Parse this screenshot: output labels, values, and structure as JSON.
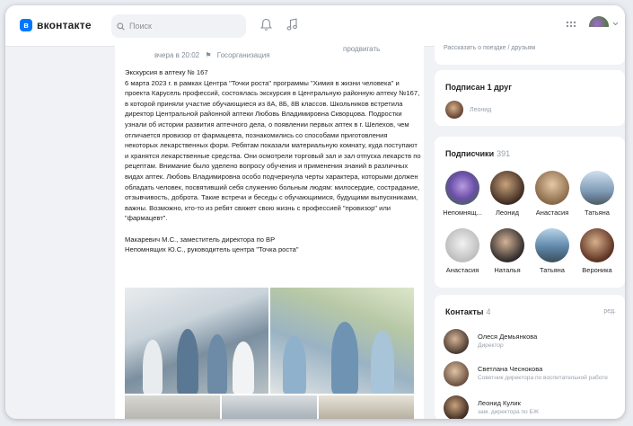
{
  "header": {
    "logo_text": "вконтакте",
    "search_placeholder": "Поиск"
  },
  "post": {
    "meta_time": "вчера в 20:02",
    "meta_org": "Госорганизация",
    "side_label": "продвигать",
    "title": "Экскурсия в аптеку № 167",
    "body": "6 марта 2023 г. в рамках Центра \"Точки роста\" программы \"Химия в жизни человека\" и проекта Карусель профессий, состоялась экскурсия в Центральную районную аптеку №167, в которой приняли участие обучающиеся из 8А, 8Б, 8В классов. Школьников встретила директор Центральной районной аптеки Любовь Владимировна Скворцова. Подростки узнали об истории развития аптечного дела, о появлении первых аптек в г. Шелехов, чем отличается провизор от фармацевта, познакомились со способами приготовления некоторых лекарственных форм. Ребятам показали материальную комнату, куда поступают и хранятся лекарственные средства. Они осмотрели торговый зал и зал отпуска лекарств по рецептам. Внимание было уделено вопросу обучения и применения знаний в различных видах аптек. Любовь Владимировна особо подчеркнула черты характера, которыми должен обладать человек, посвятивший себя служению больным людям: милосердие, сострадание, отзывчивость, доброта. Такие встречи и беседы с обучающимися, будущими выпускниками, важны. Возможно, кто-то из ребят свяжет свою жизнь с профессией \"провизор\" или \"фармацевт\".",
    "sign1": "Макаревич М.С., заместитель директора по ВР",
    "sign2": "Непомнящих Ю.С., руководитель центра \"Точка роста\""
  },
  "sidebar": {
    "top_line": "Рассказать о поездке / друзьям",
    "subscribed": {
      "title": "Подписан 1 друг",
      "name": "Леонид"
    },
    "followers": {
      "title": "Подписчики",
      "count": "391",
      "items": [
        {
          "name": "Непомнящ..."
        },
        {
          "name": "Леонид"
        },
        {
          "name": "Анастасия"
        },
        {
          "name": "Татьяна"
        },
        {
          "name": "Анастасия"
        },
        {
          "name": "Наталья"
        },
        {
          "name": "Татьяна"
        },
        {
          "name": "Вероника"
        }
      ]
    },
    "contacts": {
      "title": "Контакты",
      "count": "4",
      "edit": "ред.",
      "items": [
        {
          "name": "Олеся Демьянкова",
          "role": "Директор"
        },
        {
          "name": "Светлана Чеснокова",
          "role": "Советник директора по воспитательной работе"
        },
        {
          "name": "Леонид Кулик",
          "role": "зам. директора по БЖ"
        }
      ]
    }
  }
}
